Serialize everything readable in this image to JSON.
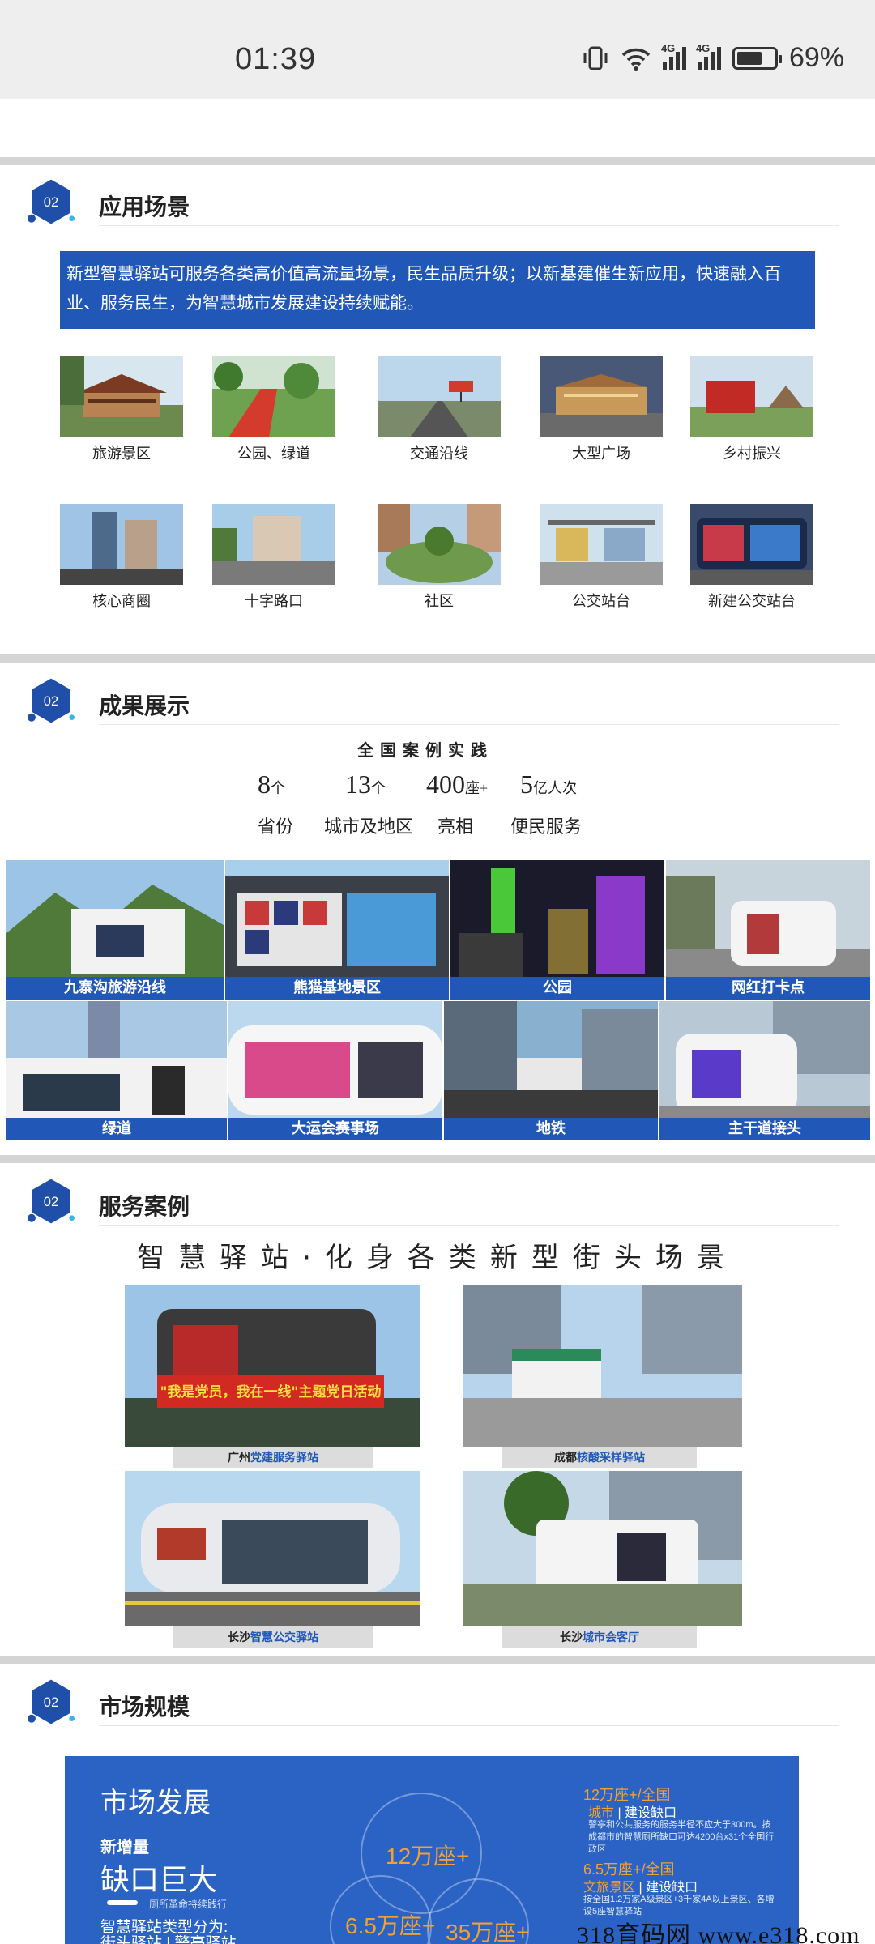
{
  "status_bar": {
    "time": "01:39",
    "battery": "69%",
    "net1": "4G",
    "net2": "4G",
    "battery_level": 0.69
  },
  "section_badge": "02",
  "sections": {
    "scenes": "应用场景",
    "results": "成果展示",
    "cases": "服务案例",
    "market": "市场规模"
  },
  "intro": "新型智慧驿站可服务各类高价值高流量场景，民生品质升级；以新基建催生新应用，快速融入百业、服务民生，为智慧城市发展建设持续赋能。",
  "scenes": [
    {
      "label": "旅游景区"
    },
    {
      "label": "公园、绿道"
    },
    {
      "label": "交通沿线"
    },
    {
      "label": "大型广场"
    },
    {
      "label": "乡村振兴"
    },
    {
      "label": "核心商圈"
    },
    {
      "label": "十字路口"
    },
    {
      "label": "社区"
    },
    {
      "label": "公交站台"
    },
    {
      "label": "新建公交站台"
    }
  ],
  "results": {
    "heading": "全国案例实践",
    "stats": [
      {
        "num": "8",
        "unit": "个",
        "cap": "省份"
      },
      {
        "num": "13",
        "unit": "个",
        "cap": "城市及地区"
      },
      {
        "num": "400",
        "unit": "座+",
        "cap": "亮相"
      },
      {
        "num": "5",
        "unit": "亿人次",
        "cap": "便民服务"
      }
    ],
    "photos": [
      {
        "label": "九寨沟旅游沿线"
      },
      {
        "label": "熊猫基地景区"
      },
      {
        "label": "公园"
      },
      {
        "label": "网红打卡点"
      },
      {
        "label": "绿道"
      },
      {
        "label": "大运会赛事场"
      },
      {
        "label": "地铁"
      },
      {
        "label": "主干道接头"
      }
    ]
  },
  "cases": {
    "title": "智慧驿站·化身各类新型街头场景",
    "banner": "\"我是党员，我在一线\"主题党日活动",
    "items": [
      {
        "city": "广州",
        "name": "党建服务驿站"
      },
      {
        "city": "成都",
        "name": "核酸采样驿站"
      },
      {
        "city": "长沙",
        "name": "智慧公交驿站"
      },
      {
        "city": "长沙",
        "name": "城市会客厅"
      }
    ]
  },
  "market": {
    "title": "市场发展",
    "new_label": "新增量",
    "gap": "缺口巨大",
    "gap_sub": "厕所革命持续践行",
    "types_line1": "智慧驿站类型分为:",
    "types_line2": "街头驿站 | 警亭驿站",
    "circle1": "12万座+",
    "circle2": "6.5万座+",
    "circle3": "35万座+",
    "r1_head": "12万座+/全国",
    "r1_tag": "城市",
    "r1_sub": "建设缺口",
    "r1_text": "警亭和公共服务的服务半径不应大于300m。按成都市的智慧厕所缺口可达4200台x31个全国行政区",
    "r2_head": "6.5万座+/全国",
    "r2_tag": "文旅景区",
    "r2_sub": "建设缺口",
    "r2_text": "按全国1.2万家A级景区+3千家4A以上景区、各增设5座智慧驿站"
  },
  "watermark": "318育码网  www.e318.com",
  "colors": {
    "accent": "#2158b8",
    "divider": "#d4d4d4",
    "statusbar": "#eeeeee"
  }
}
